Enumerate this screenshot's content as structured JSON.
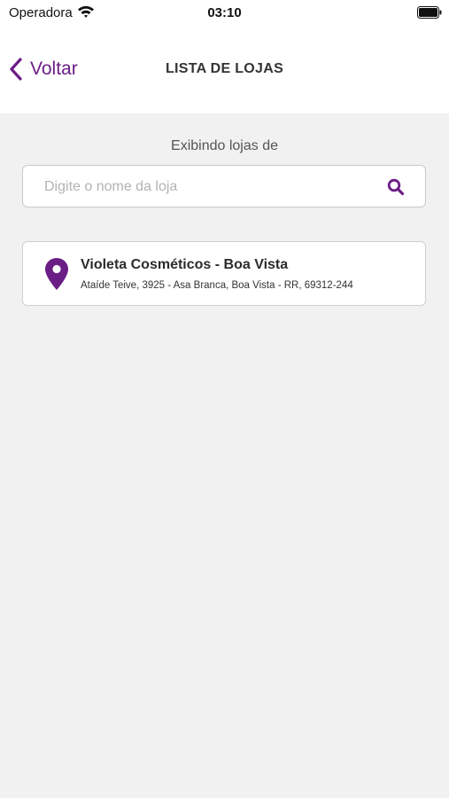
{
  "status_bar": {
    "carrier": "Operadora",
    "time": "03:10"
  },
  "nav": {
    "back_label": "Voltar",
    "title": "LISTA DE LOJAS"
  },
  "subtitle": "Exibindo lojas de",
  "search": {
    "placeholder": "Digite o nome da loja",
    "value": ""
  },
  "stores": [
    {
      "name": "Violeta Cosméticos - Boa Vista",
      "address": "Ataíde Teive, 3925 - Asa Branca, Boa Vista - RR, 69312-244",
      "icon": "map-pin-icon"
    }
  ],
  "colors": {
    "accent": "#6b1d86",
    "background": "#f1f1f1",
    "header": "#ffffff"
  }
}
